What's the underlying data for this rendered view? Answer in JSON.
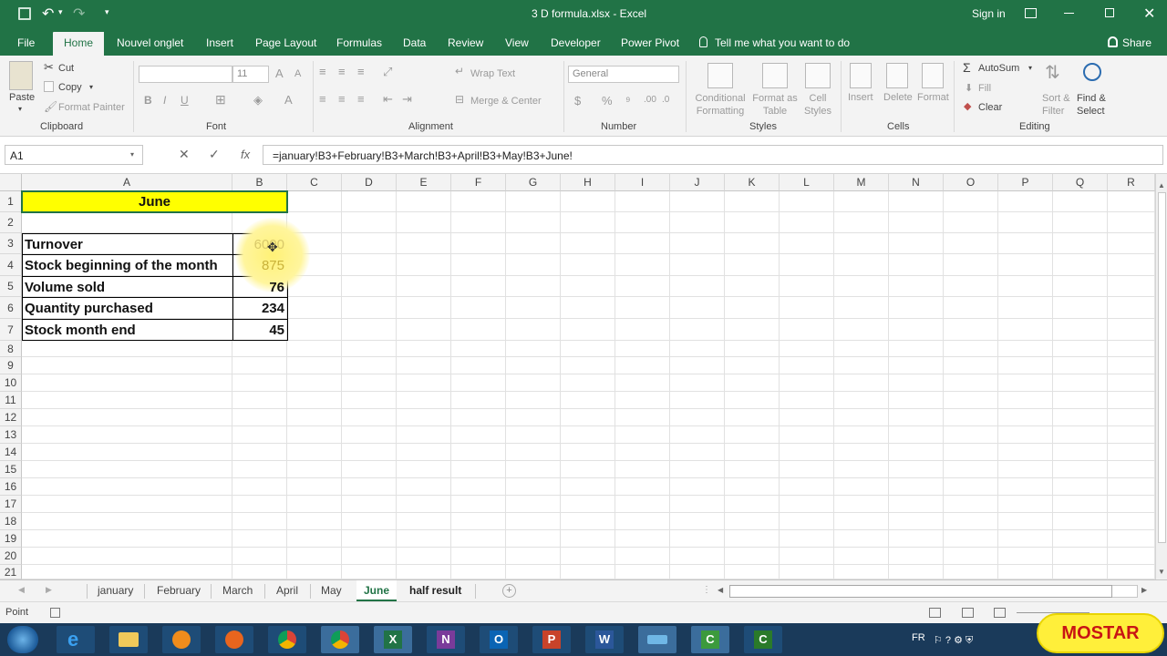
{
  "window": {
    "title": "3 D formula.xlsx - Excel",
    "sign_in": "Sign in"
  },
  "tabs": [
    "File",
    "Home",
    "Nouvel onglet",
    "Insert",
    "Page Layout",
    "Formulas",
    "Data",
    "Review",
    "View",
    "Developer",
    "Power Pivot"
  ],
  "tell_me": "Tell me what you want to do",
  "share": "Share",
  "ribbon": {
    "paste": "Paste",
    "cut": "Cut",
    "copy": "Copy",
    "format_painter": "Format Painter",
    "clipboard": "Clipboard",
    "font_size": "11",
    "font": "Font",
    "wrap_text": "Wrap Text",
    "merge_center": "Merge & Center",
    "alignment": "Alignment",
    "number_format": "General",
    "number": "Number",
    "conditional_formatting": [
      "Conditional",
      "Formatting"
    ],
    "format_as_table": [
      "Format as",
      "Table"
    ],
    "cell_styles": [
      "Cell",
      "Styles"
    ],
    "styles": "Styles",
    "insert": "Insert",
    "delete": "Delete",
    "format": "Format",
    "cells": "Cells",
    "autosum": "AutoSum",
    "fill": "Fill",
    "clear": "Clear",
    "sort_filter": [
      "Sort &",
      "Filter"
    ],
    "find_select": [
      "Find &",
      "Select"
    ],
    "editing": "Editing"
  },
  "formula_bar": {
    "name_box": "A1",
    "fx": "fx",
    "formula": "=january!B3+February!B3+March!B3+April!B3+May!B3+June!"
  },
  "columns": [
    "A",
    "B",
    "C",
    "D",
    "E",
    "F",
    "G",
    "H",
    "I",
    "J",
    "K",
    "L",
    "M",
    "N",
    "O",
    "P",
    "Q",
    "R"
  ],
  "rows": [
    "1",
    "2",
    "3",
    "4",
    "5",
    "6",
    "7",
    "8",
    "9",
    "10",
    "11",
    "12",
    "13",
    "14",
    "15",
    "16",
    "17",
    "18",
    "19",
    "20",
    "21"
  ],
  "cells": {
    "a1": "June",
    "labels": [
      "Turnover",
      "Stock beginning of the month",
      "Volume sold",
      "Quantity purchased",
      "Stock month end"
    ],
    "values": [
      "6000",
      "875",
      "76",
      "234",
      "45"
    ]
  },
  "sheets": [
    "january",
    "February",
    "March",
    "April",
    "May",
    "June",
    "half result"
  ],
  "active_sheet": "June",
  "status": {
    "mode": "Point"
  },
  "taskbar": {
    "language": "FR",
    "badge": "MOSTAR"
  },
  "colors": {
    "excel_green": "#217346",
    "highlight_yellow": "#ffff00",
    "cursor_glow": "#fff176"
  }
}
